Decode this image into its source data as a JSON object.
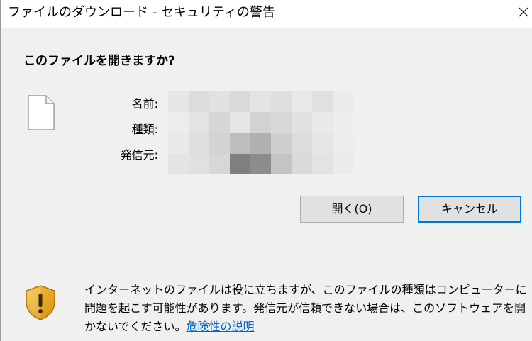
{
  "window": {
    "title": "ファイルのダウンロード - セキュリティの警告",
    "close_glyph": "✕"
  },
  "prompt": {
    "heading": "このファイルを開きますか?"
  },
  "file_info": {
    "name_label": "名前:",
    "type_label": "種類:",
    "publisher_label": "発信元:",
    "file_icon": "document-icon",
    "values_redacted": true
  },
  "buttons": {
    "open_label": "開く(O)",
    "cancel_label": "キャンセル"
  },
  "warning": {
    "icon": "shield-warning-icon",
    "text": "インターネットのファイルは役に立ちますが、このファイルの種類はコンピューターに問題を起こす可能性があります。発信元が信頼できない場合は、このソフトウェアを開かないでください。",
    "link_text": "危険性の説明"
  },
  "colors": {
    "background": "#f0f0f0",
    "titlebar": "#ffffff",
    "link": "#0066cc",
    "focus_border": "#0078d7",
    "shield_gold": "#e8a317"
  }
}
